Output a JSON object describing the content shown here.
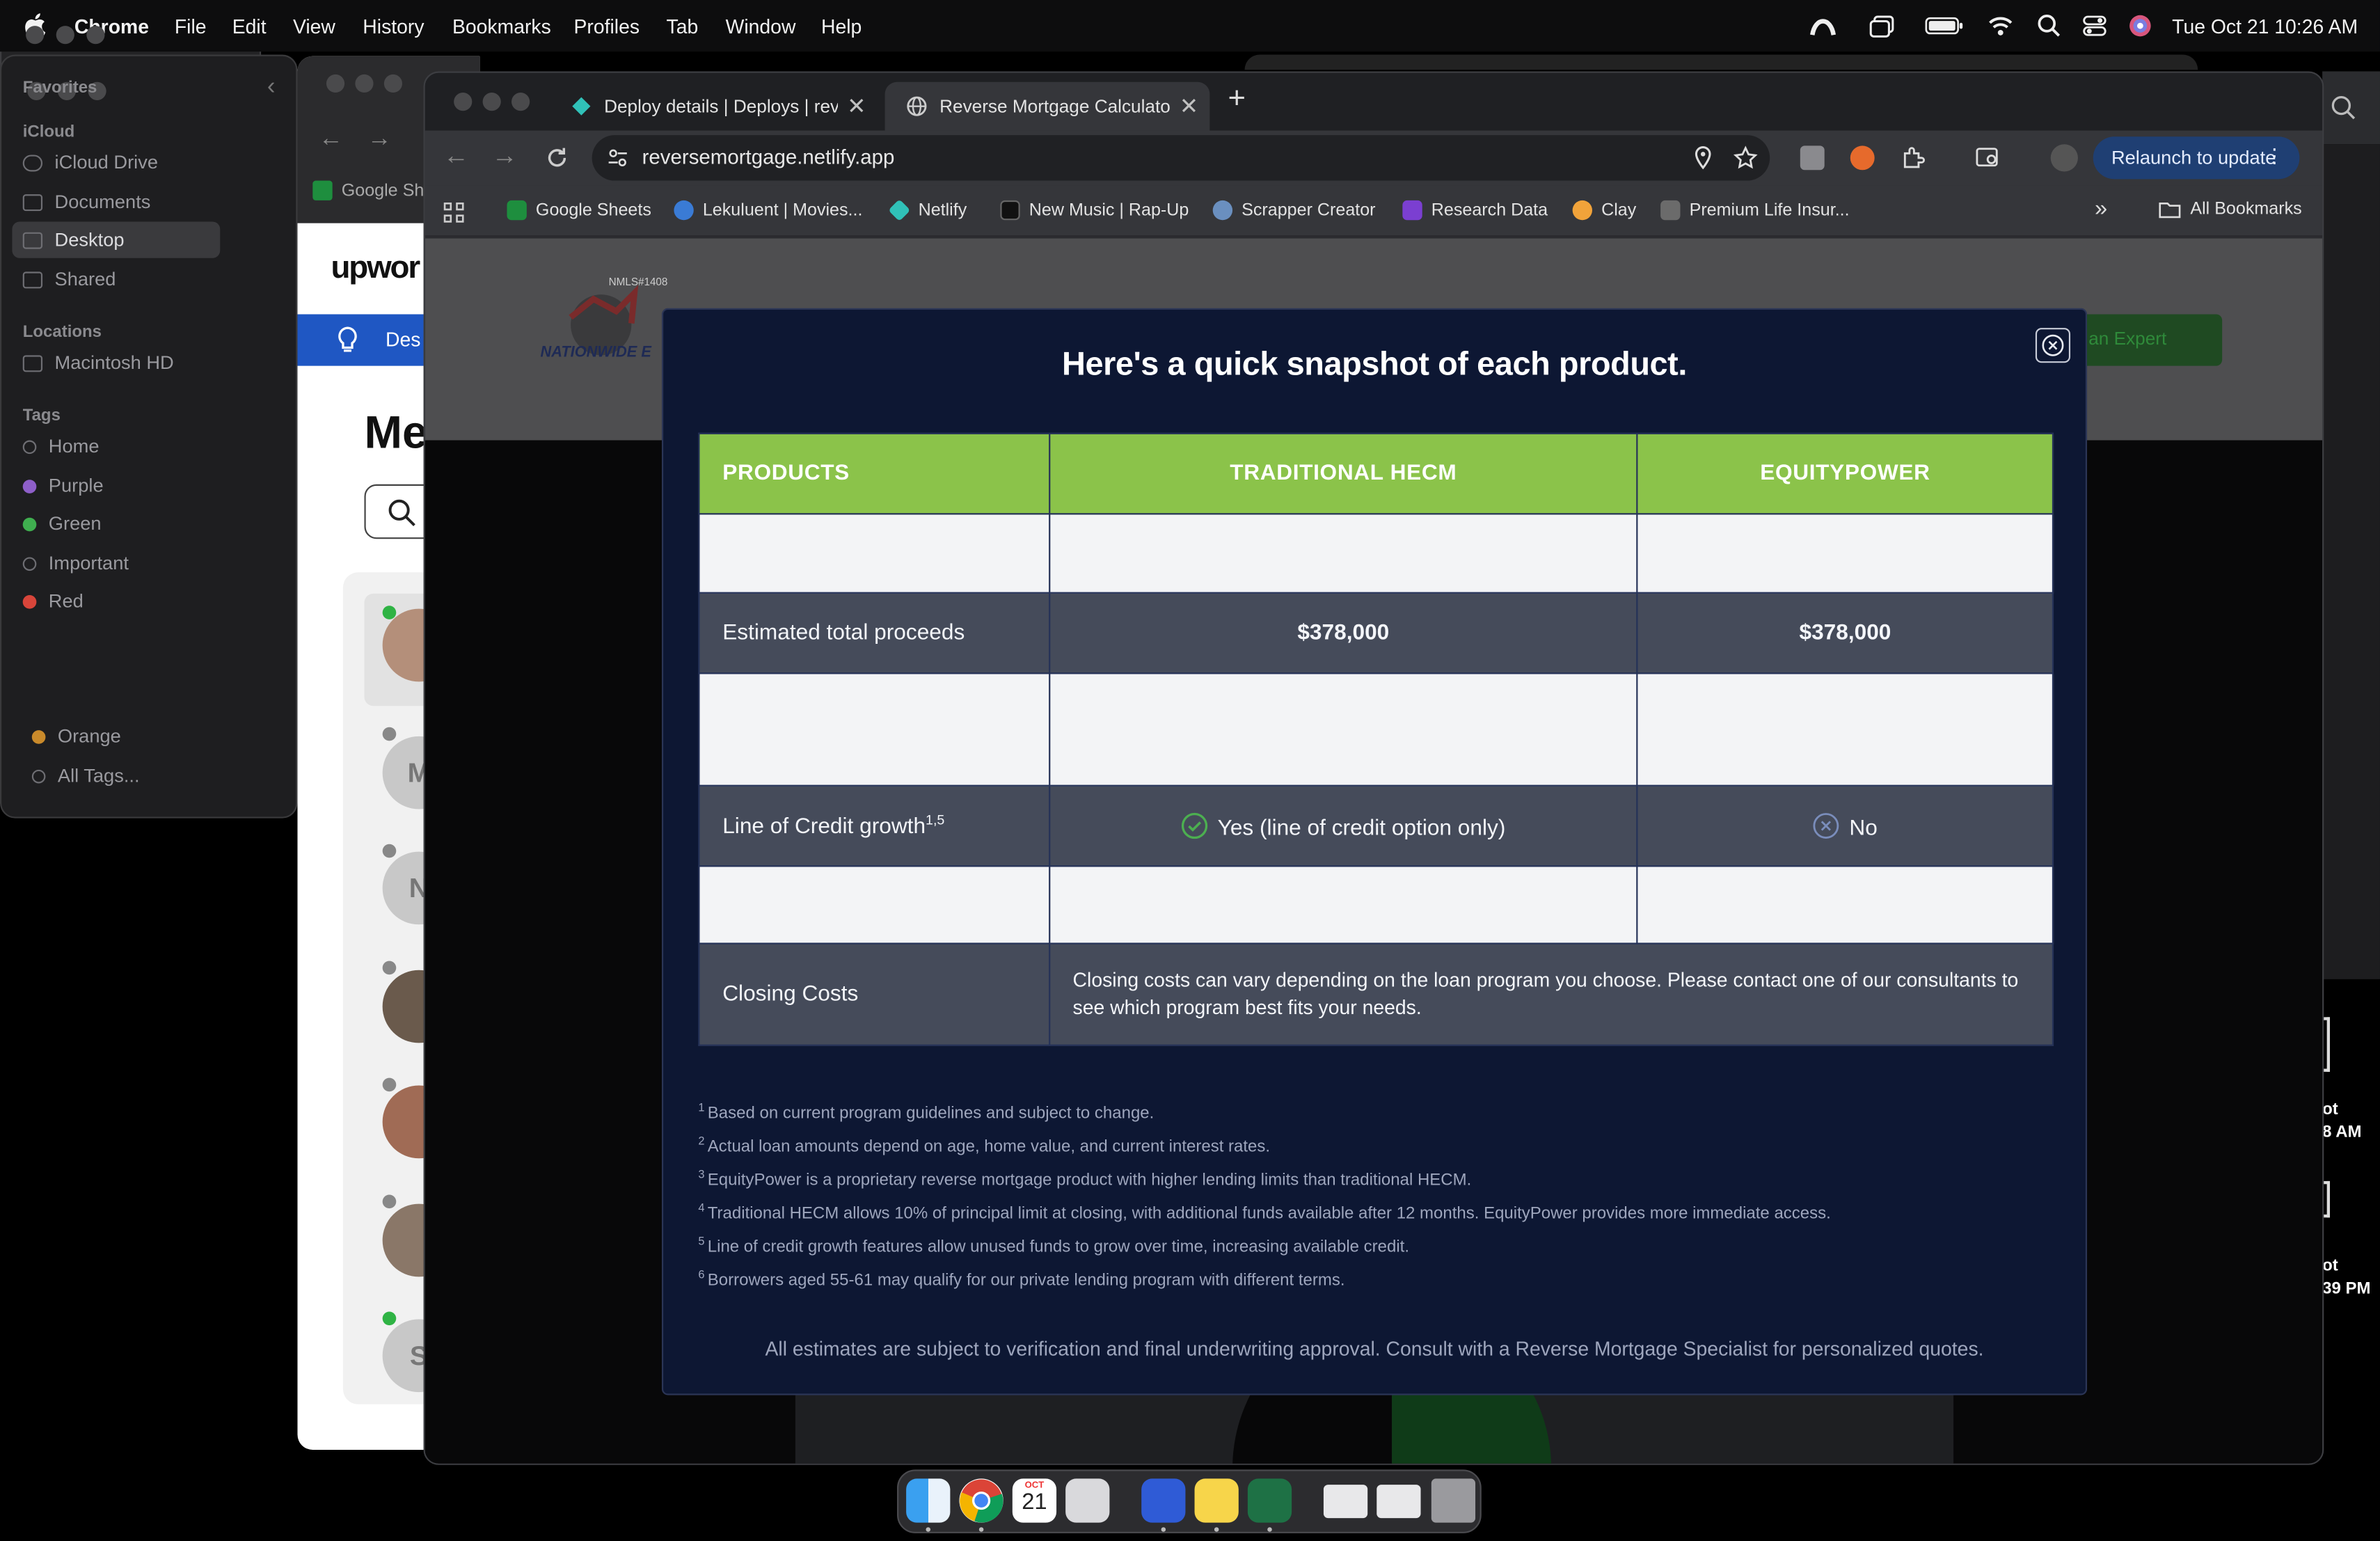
{
  "menubar": {
    "app": "Chrome",
    "items": [
      "File",
      "Edit",
      "View",
      "History",
      "Bookmarks",
      "Profiles",
      "Tab",
      "Window",
      "Help"
    ],
    "clock": "Tue Oct 21  10:26 AM"
  },
  "finder": {
    "back_items": [
      "Orange",
      "All Tags..."
    ],
    "sections": {
      "favorites": "Favorites",
      "icloud": "iCloud",
      "locations": "Locations",
      "tags": "Tags"
    },
    "icloud_items": [
      "iCloud Drive",
      "Documents",
      "Desktop",
      "Shared"
    ],
    "location_items": [
      "Macintosh HD"
    ],
    "tag_items": [
      "Home",
      "Purple",
      "Green",
      "Important",
      "Red"
    ]
  },
  "upwork": {
    "bookmark": "Google Sh",
    "brand": "upwor",
    "banner_text": "Des",
    "heading": "Me",
    "avatar_letters": [
      "M",
      "N",
      "S"
    ]
  },
  "desktop_right": {
    "line1": "ot",
    "line2": "8 AM",
    "line3": "ot",
    "line4": "39 PM"
  },
  "chrome": {
    "tabs": [
      {
        "title": "Deploy details | Deploys | reve",
        "active": false
      },
      {
        "title": "Reverse Mortgage Calculator",
        "active": true
      }
    ],
    "new_tab": "+",
    "url": "reversemortgage.netlify.app",
    "relaunch_label": "Relaunch to update",
    "bookmarks": [
      "Google Sheets",
      "Lekuluent | Movies...",
      "Netlify",
      "New Music | Rap-Up",
      "Scrapper Creator",
      "Research Data",
      "Clay",
      "Premium Life Insur..."
    ],
    "overflow": "»",
    "all_bookmarks": "All Bookmarks"
  },
  "site": {
    "logo_nmls": "NMLS#1408",
    "logo_text": "NATIONWIDE E",
    "expert_button": "h an Expert"
  },
  "modal": {
    "title": "Here's a quick snapshot of each product.",
    "headers": [
      "PRODUCTS",
      "TRADITIONAL HECM",
      "EQUITYPOWER"
    ],
    "rows": {
      "proceeds": {
        "label": "Estimated total proceeds",
        "hecm": "$378,000",
        "equity": "$378,000"
      },
      "loc": {
        "label": "Line of Credit growth",
        "sup": "1,5",
        "hecm": "Yes (line of credit option only)",
        "equity": "No"
      },
      "closing": {
        "label": "Closing Costs",
        "text": "Closing costs can vary depending on the loan program you choose. Please contact one of our consultants to see which program best fits your needs."
      }
    },
    "footnotes": [
      {
        "n": "1",
        "text": "Based on current program guidelines and subject to change."
      },
      {
        "n": "2",
        "text": "Actual loan amounts depend on age, home value, and current interest rates."
      },
      {
        "n": "3",
        "text": "EquityPower is a proprietary reverse mortgage product with higher lending limits than traditional HECM."
      },
      {
        "n": "4",
        "text": "Traditional HECM allows 10% of principal limit at closing, with additional funds available after 12 months. EquityPower provides more immediate access."
      },
      {
        "n": "5",
        "text": "Line of credit growth features allow unused funds to grow over time, increasing available credit."
      },
      {
        "n": "6",
        "text": "Borrowers aged 55-61 may qualify for our private lending program with different terms."
      }
    ],
    "disclaimer": "All estimates are subject to verification and final underwriting approval. Consult with a Reverse Mortgage Specialist for personalized quotes."
  },
  "dock": {
    "calendar_month": "OCT",
    "calendar_day": "21"
  }
}
